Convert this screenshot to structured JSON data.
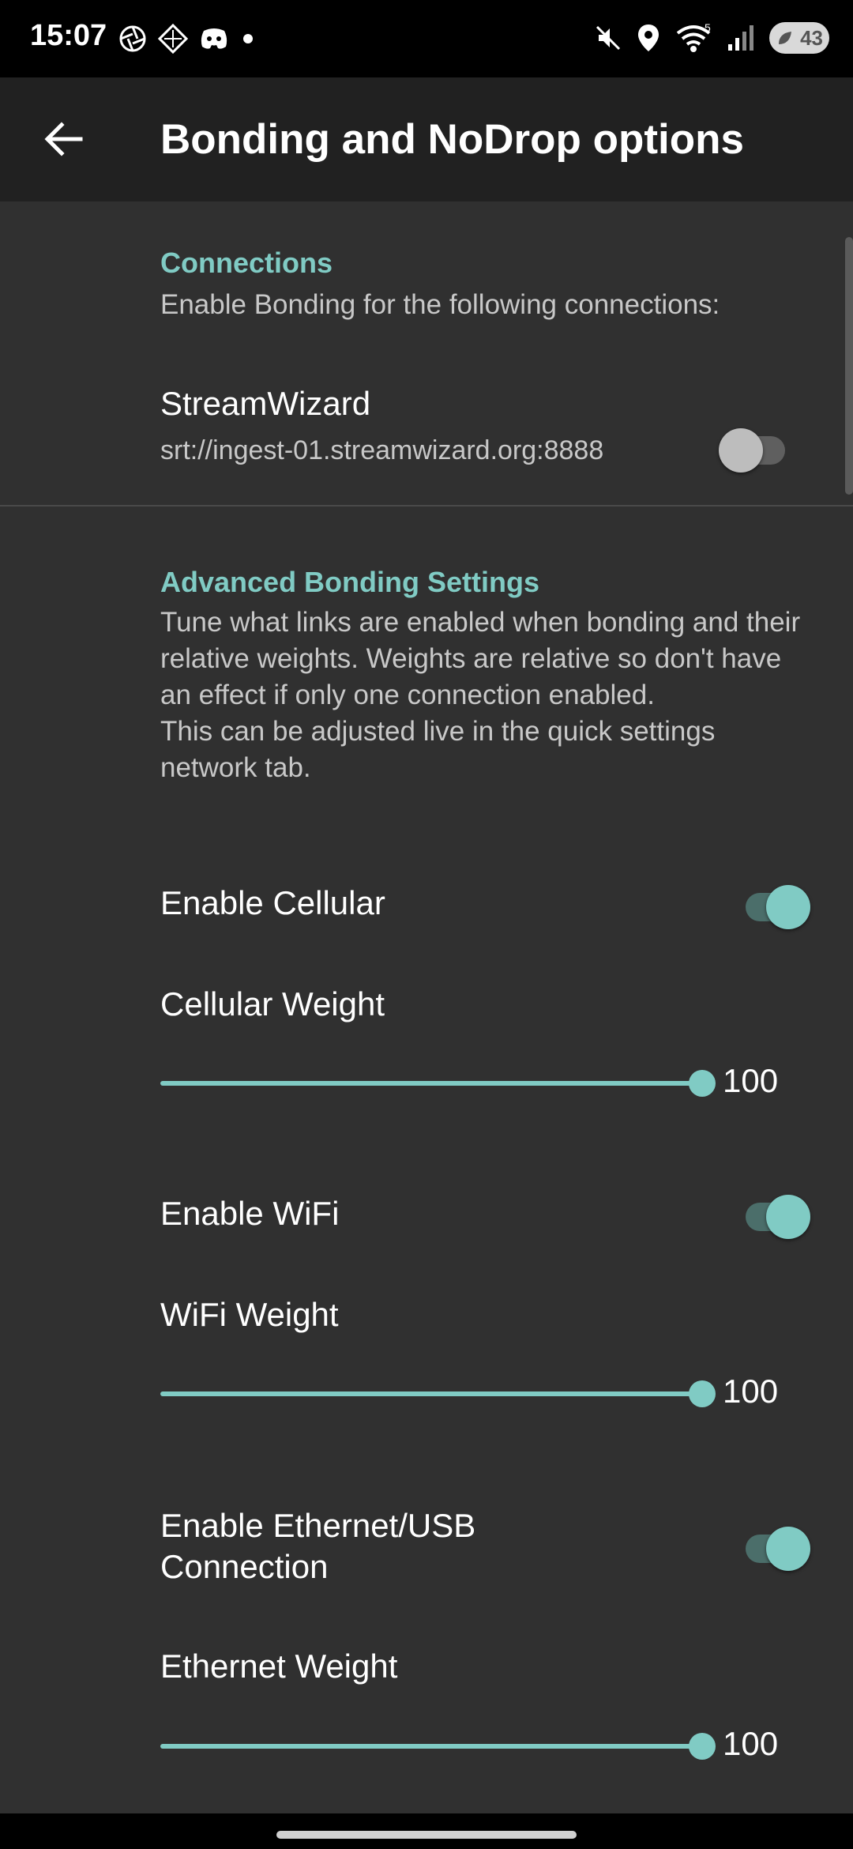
{
  "status_bar": {
    "time": "15:07",
    "battery": "43",
    "signal_label": "5"
  },
  "app_bar": {
    "title": "Bonding and NoDrop options"
  },
  "connections": {
    "header": "Connections",
    "description": "Enable Bonding for the following connections:",
    "items": [
      {
        "name": "StreamWizard",
        "url": "srt://ingest-01.streamwizard.org:8888",
        "enabled": false
      }
    ]
  },
  "advanced": {
    "header": "Advanced Bonding Settings",
    "description_line1": "Tune what links are enabled when bonding and their relative weights. Weights are relative so don't have an effect if only one connection enabled.",
    "description_line2": "This can be adjusted live in the quick settings network tab.",
    "cellular": {
      "enable_label": "Enable Cellular",
      "enabled": true,
      "weight_label": "Cellular Weight",
      "weight_value": "100",
      "weight_fraction": 1.0
    },
    "wifi": {
      "enable_label": "Enable WiFi",
      "enabled": true,
      "weight_label": "WiFi Weight",
      "weight_value": "100",
      "weight_fraction": 1.0
    },
    "ethernet": {
      "enable_label": "Enable Ethernet/USB Connection",
      "enabled": true,
      "weight_label": "Ethernet Weight",
      "weight_value": "100",
      "weight_fraction": 1.0
    }
  },
  "colors": {
    "accent": "#80cbc4",
    "background": "#303030",
    "app_bar": "#212121"
  }
}
